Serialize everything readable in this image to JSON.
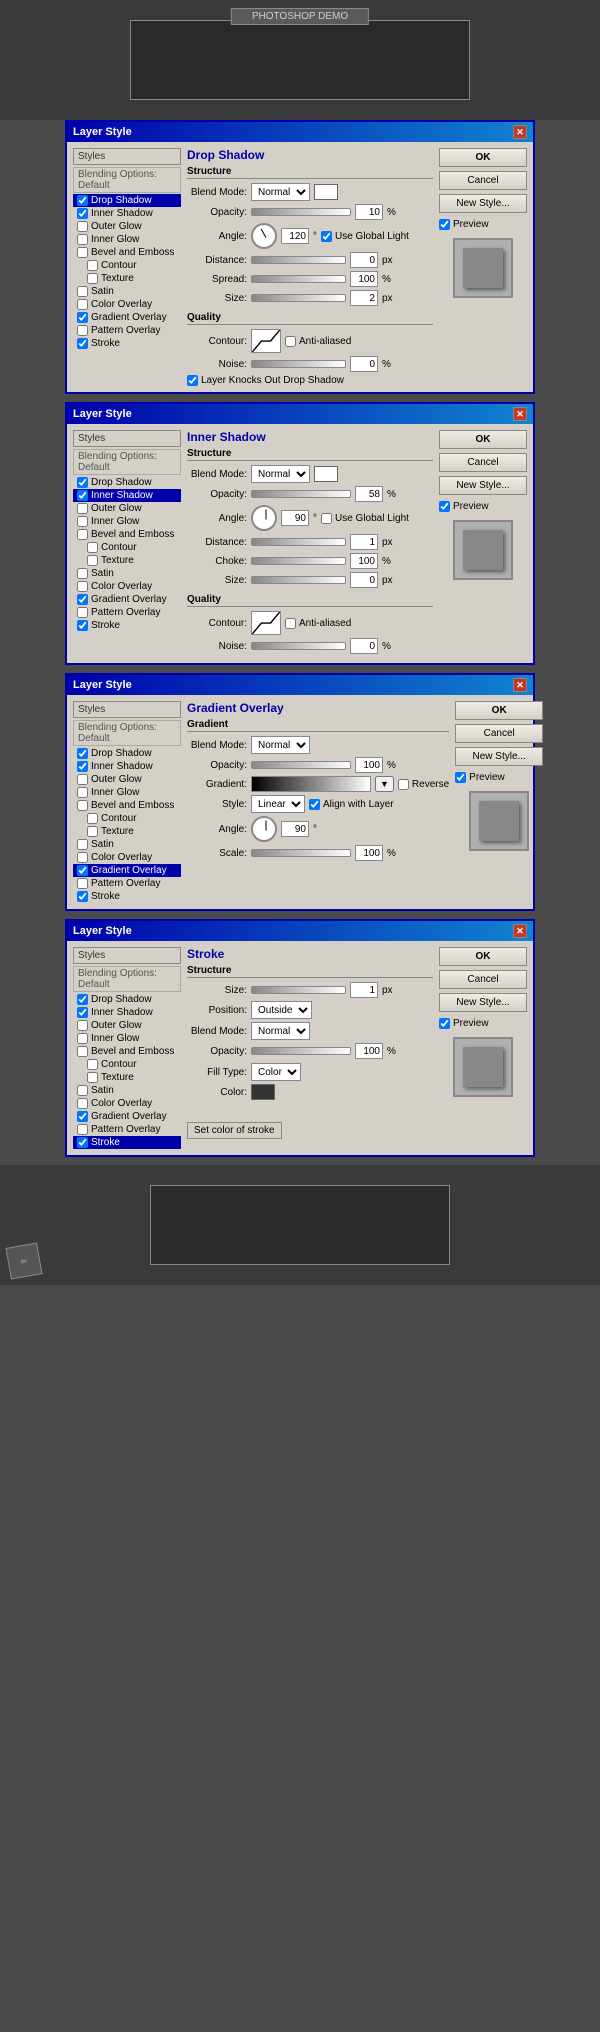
{
  "app": {
    "title": "Photoshop"
  },
  "canvas_title": "PHOTOSHOP DEMO",
  "dialogs": [
    {
      "id": "drop-shadow",
      "title": "Layer Style",
      "effect_title": "Drop Shadow",
      "section1": "Structure",
      "blend_mode_label": "Blend Mode:",
      "blend_mode_value": "Normal",
      "opacity_label": "Opacity:",
      "opacity_value": "10",
      "opacity_unit": "%",
      "angle_label": "Angle:",
      "angle_value": "120",
      "angle_unit": "°",
      "use_global_light_label": "Use Global Light",
      "distance_label": "Distance:",
      "distance_value": "0",
      "distance_unit": "px",
      "spread_label": "Spread:",
      "spread_value": "100",
      "spread_unit": "%",
      "size_label": "Size:",
      "size_value": "2",
      "size_unit": "px",
      "section2": "Quality",
      "contour_label": "Contour:",
      "anti_aliased_label": "Anti-aliased",
      "noise_label": "Noise:",
      "noise_value": "0",
      "noise_unit": "%",
      "knock_label": "Layer Knocks Out Drop Shadow",
      "ok_label": "OK",
      "cancel_label": "Cancel",
      "new_style_label": "New Style...",
      "preview_label": "Preview",
      "active_style": "Drop Shadow"
    },
    {
      "id": "inner-shadow",
      "title": "Layer Style",
      "effect_title": "Inner Shadow",
      "section1": "Structure",
      "blend_mode_label": "Blend Mode:",
      "blend_mode_value": "Normal",
      "opacity_label": "Opacity:",
      "opacity_value": "58",
      "opacity_unit": "%",
      "angle_label": "Angle:",
      "angle_value": "90",
      "angle_unit": "°",
      "use_global_light_label": "Use Global Light",
      "distance_label": "Distance:",
      "distance_value": "1",
      "distance_unit": "px",
      "choke_label": "Choke:",
      "choke_value": "100",
      "choke_unit": "%",
      "size_label": "Size:",
      "size_value": "0",
      "size_unit": "px",
      "section2": "Quality",
      "contour_label": "Contour:",
      "anti_aliased_label": "Anti-aliased",
      "noise_label": "Noise:",
      "noise_value": "0",
      "noise_unit": "%",
      "ok_label": "OK",
      "cancel_label": "Cancel",
      "new_style_label": "New Style...",
      "preview_label": "Preview",
      "active_style": "Inner Shadow"
    },
    {
      "id": "gradient-overlay",
      "title": "Layer Style",
      "effect_title": "Gradient Overlay",
      "section1": "Gradient",
      "blend_mode_label": "Blend Mode:",
      "blend_mode_value": "Normal",
      "opacity_label": "Opacity:",
      "opacity_value": "100",
      "opacity_unit": "%",
      "gradient_label": "Gradient:",
      "reverse_label": "Reverse",
      "style_label": "Style:",
      "style_value": "Linear",
      "align_layer_label": "Align with Layer",
      "angle_label": "Angle:",
      "angle_value": "90",
      "angle_unit": "°",
      "scale_label": "Scale:",
      "scale_value": "100",
      "scale_unit": "%",
      "ok_label": "OK",
      "cancel_label": "Cancel",
      "new_style_label": "New Style...",
      "preview_label": "Preview",
      "active_style": "Gradient Overlay"
    },
    {
      "id": "stroke",
      "title": "Layer Style",
      "effect_title": "Stroke",
      "section1": "Structure",
      "size_label": "Size:",
      "size_value": "1",
      "size_unit": "px",
      "position_label": "Position:",
      "position_value": "Outside",
      "blend_mode_label": "Blend Mode:",
      "blend_mode_value": "Normal",
      "opacity_label": "Opacity:",
      "opacity_value": "100",
      "opacity_unit": "%",
      "fill_type_label": "Fill Type:",
      "fill_type_value": "Color",
      "color_label": "Color:",
      "set_color_label": "Set color of stroke",
      "ok_label": "OK",
      "cancel_label": "Cancel",
      "new_style_label": "New Style...",
      "preview_label": "Preview",
      "active_style": "Stroke"
    }
  ],
  "styles_list": {
    "header": "Styles",
    "blending_options": "Blending Options: Default",
    "items": [
      {
        "label": "Drop Shadow",
        "checked": true
      },
      {
        "label": "Inner Shadow",
        "checked": true
      },
      {
        "label": "Outer Glow",
        "checked": false
      },
      {
        "label": "Inner Glow",
        "checked": false
      },
      {
        "label": "Bevel and Emboss",
        "checked": false
      },
      {
        "label": "Contour",
        "checked": false,
        "sub": true
      },
      {
        "label": "Texture",
        "checked": false,
        "sub": true
      },
      {
        "label": "Satin",
        "checked": false
      },
      {
        "label": "Color Overlay",
        "checked": false
      },
      {
        "label": "Gradient Overlay",
        "checked": true
      },
      {
        "label": "Pattern Overlay",
        "checked": false
      },
      {
        "label": "Stroke",
        "checked": true
      }
    ]
  }
}
